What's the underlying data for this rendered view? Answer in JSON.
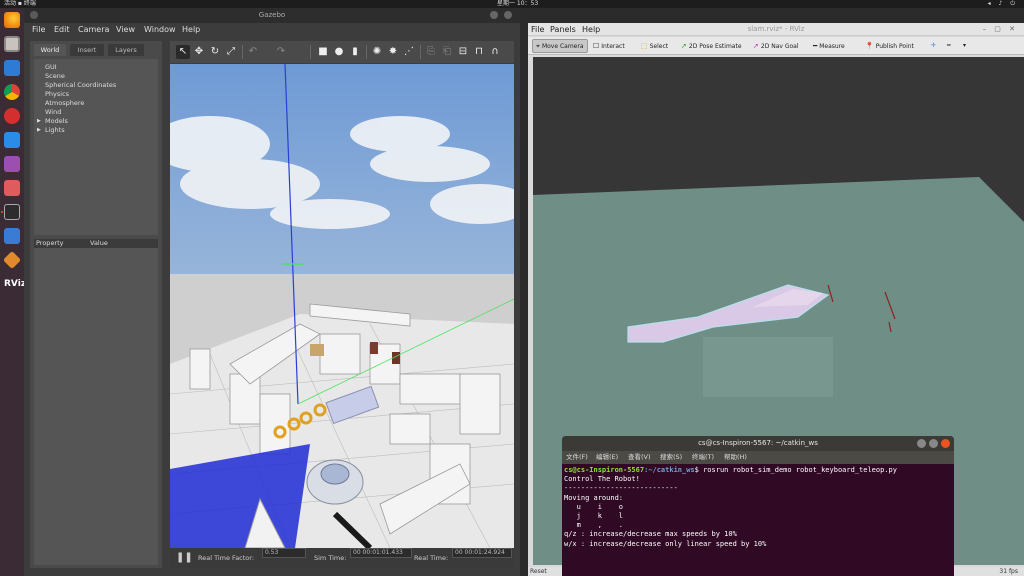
{
  "topbar": {
    "activities": "活动",
    "app": "终端",
    "clock": "星期一 10：53"
  },
  "dock": [
    "firefox-icon",
    "files-icon",
    "software-icon",
    "chrome-icon",
    "terminal-red-icon",
    "vscode-icon",
    "image-viewer-icon",
    "tweaks-icon",
    "terminal-icon",
    "remote-icon",
    "gazebo-icon",
    "rviz-icon"
  ],
  "gazebo": {
    "title": "Gazebo",
    "menu": [
      "File",
      "Edit",
      "Camera",
      "View",
      "Window",
      "Help"
    ],
    "tabs": [
      "World",
      "Insert",
      "Layers"
    ],
    "tree": [
      {
        "label": "GUI",
        "expandable": false
      },
      {
        "label": "Scene",
        "expandable": false
      },
      {
        "label": "Spherical Coordinates",
        "expandable": false
      },
      {
        "label": "Physics",
        "expandable": false
      },
      {
        "label": "Atmosphere",
        "expandable": false
      },
      {
        "label": "Wind",
        "expandable": false
      },
      {
        "label": "Models",
        "expandable": true
      },
      {
        "label": "Lights",
        "expandable": true
      }
    ],
    "prop_headers": [
      "Property",
      "Value"
    ],
    "status": {
      "rtf_label": "Real Time Factor:",
      "rtf": "0.53",
      "sim_label": "Sim Time:",
      "sim": "00 00:01:01.433",
      "real_label": "Real Time:",
      "real": "00 00:01:24.924"
    }
  },
  "rviz": {
    "title": "slam.rviz* - RViz",
    "menu": [
      "File",
      "Panels",
      "Help"
    ],
    "tools": [
      {
        "label": "Move Camera",
        "icon": "camera-icon",
        "active": true
      },
      {
        "label": "Interact",
        "icon": "interact-icon",
        "active": false
      },
      {
        "label": "Select",
        "icon": "select-icon",
        "active": false
      },
      {
        "label": "2D Pose Estimate",
        "icon": "pose-icon",
        "active": false
      },
      {
        "label": "2D Nav Goal",
        "icon": "goal-icon",
        "active": false
      },
      {
        "label": "Measure",
        "icon": "measure-icon",
        "active": false
      },
      {
        "label": "Publish Point",
        "icon": "point-icon",
        "active": false
      }
    ],
    "reset": "Reset",
    "fps": "31 fps"
  },
  "terminal": {
    "title": "cs@cs-Inspiron-5567: ~/catkin_ws",
    "menu": [
      "文件(F)",
      "编辑(E)",
      "查看(V)",
      "搜索(S)",
      "终端(T)",
      "帮助(H)"
    ],
    "prompt_user": "cs@cs-Inspiron-5567",
    "prompt_path": ":~/catkin_ws",
    "command": "$ rosrun robot_sim_demo robot_keyboard_teleop.py",
    "lines": [
      "",
      "Control The Robot!",
      "---------------------------",
      "Moving around:",
      "   u    i    o",
      "   j    k    l",
      "   m    ,    .",
      "",
      "q/z : increase/decrease max speeds by 10%",
      "w/x : increase/decrease only linear speed by 10%"
    ]
  }
}
